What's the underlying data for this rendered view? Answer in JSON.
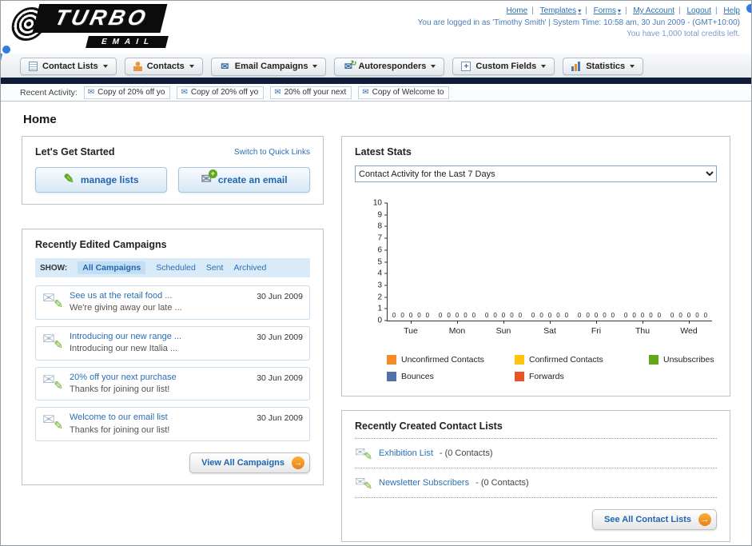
{
  "header": {
    "logo": {
      "line1": "TURBO",
      "line2": "EMAIL"
    },
    "nav_links": [
      "Home",
      "Templates",
      "Forms",
      "My Account",
      "Logout",
      "Help"
    ],
    "nav_separator": "|",
    "login_info": "You are logged in as 'Timothy Smith' | System Time: 10:58 am, 30 Jun 2009 - (GMT+10:00)",
    "credits_info": "You have 1,000 total credits left."
  },
  "tabs": [
    {
      "label": "Contact Lists"
    },
    {
      "label": "Contacts"
    },
    {
      "label": "Email Campaigns"
    },
    {
      "label": "Autoresponders"
    },
    {
      "label": "Custom Fields"
    },
    {
      "label": "Statistics"
    }
  ],
  "recent_activity": {
    "label": "Recent Activity:",
    "items": [
      "Copy of 20% off yo",
      "Copy of 20% off yo",
      "20% off your next",
      "Copy of Welcome to"
    ]
  },
  "page_title": "Home",
  "get_started": {
    "title": "Let's Get Started",
    "switch_link": "Switch to Quick Links",
    "manage_lists_label": "manage lists",
    "create_email_label": "create an email"
  },
  "campaigns": {
    "title": "Recently Edited Campaigns",
    "show_label": "SHOW:",
    "filter_tabs": [
      "All Campaigns",
      "Scheduled",
      "Sent",
      "Archived"
    ],
    "items": [
      {
        "title": "See us at the retail food ...",
        "subtitle": "We're giving away our late ...",
        "date": "30 Jun 2009"
      },
      {
        "title": "Introducing our new range ...",
        "subtitle": "Introducing our new Italia ...",
        "date": "30 Jun 2009"
      },
      {
        "title": "20% off your next purchase",
        "subtitle": "Thanks for joining our list!",
        "date": "30 Jun 2009"
      },
      {
        "title": "Welcome to our email list",
        "subtitle": "Thanks for joining our list!",
        "date": "30 Jun 2009"
      }
    ],
    "view_all_label": "View All Campaigns"
  },
  "stats": {
    "title": "Latest Stats",
    "dropdown_value": "Contact Activity for the Last 7 Days",
    "chart_data": {
      "type": "bar",
      "title": "Contact Activity for the Last 7 Days",
      "categories": [
        "Tue",
        "Mon",
        "Sun",
        "Sat",
        "Fri",
        "Thu",
        "Wed"
      ],
      "series": [
        {
          "name": "Unconfirmed Contacts",
          "color": "#F28C28",
          "values": [
            0,
            0,
            0,
            0,
            0,
            0,
            0
          ]
        },
        {
          "name": "Confirmed Contacts",
          "color": "#FFC20E",
          "values": [
            0,
            0,
            0,
            0,
            0,
            0,
            0
          ]
        },
        {
          "name": "Unsubscribes",
          "color": "#61A61B",
          "values": [
            0,
            0,
            0,
            0,
            0,
            0,
            0
          ]
        },
        {
          "name": "Bounces",
          "color": "#5470A8",
          "values": [
            0,
            0,
            0,
            0,
            0,
            0,
            0
          ]
        },
        {
          "name": "Forwards",
          "color": "#E65525",
          "values": [
            0,
            0,
            0,
            0,
            0,
            0,
            0
          ]
        }
      ],
      "ylim": [
        0,
        10
      ],
      "ytick_step": 1,
      "grid": false,
      "legend_position": "bottom"
    }
  },
  "contact_lists": {
    "title": "Recently Created Contact Lists",
    "items": [
      {
        "name": "Exhibition List",
        "detail": "- (0 Contacts)"
      },
      {
        "name": "Newsletter Subscribers",
        "detail": "- (0 Contacts)"
      }
    ],
    "see_all_label": "See All Contact Lists"
  },
  "icons": {
    "envelope": "✉",
    "pencil": "✎",
    "arrow_right": "→",
    "plus": "+",
    "refresh": "↻"
  }
}
